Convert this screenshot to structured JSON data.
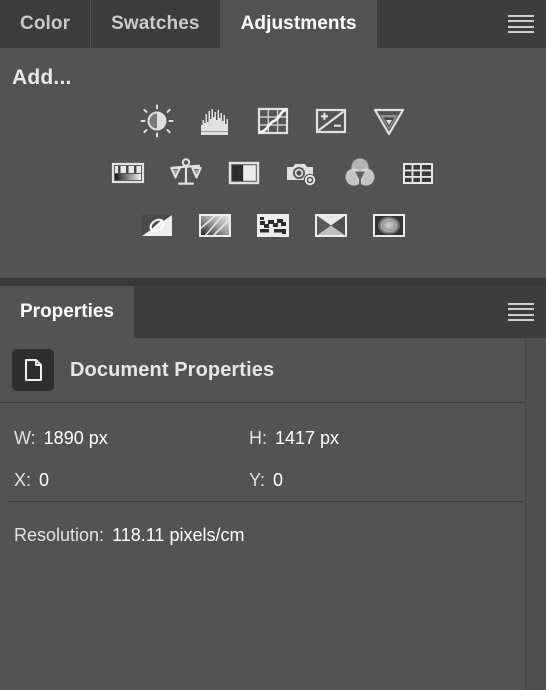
{
  "adjustments_panel": {
    "tabs": [
      {
        "label": "Color",
        "active": false
      },
      {
        "label": "Swatches",
        "active": false
      },
      {
        "label": "Adjustments",
        "active": true
      }
    ],
    "menu_icon": "hamburger-menu-icon",
    "add_label": "Add...",
    "icon_rows": [
      [
        {
          "name": "brightness-contrast-icon",
          "title": "Brightness/Contrast"
        },
        {
          "name": "levels-icon",
          "title": "Levels"
        },
        {
          "name": "curves-icon",
          "title": "Curves"
        },
        {
          "name": "exposure-icon",
          "title": "Exposure"
        },
        {
          "name": "vibrance-icon",
          "title": "Vibrance"
        }
      ],
      [
        {
          "name": "hue-saturation-icon",
          "title": "Hue/Saturation"
        },
        {
          "name": "color-balance-icon",
          "title": "Color Balance"
        },
        {
          "name": "black-and-white-icon",
          "title": "Black & White"
        },
        {
          "name": "photo-filter-icon",
          "title": "Photo Filter"
        },
        {
          "name": "channel-mixer-icon",
          "title": "Channel Mixer"
        },
        {
          "name": "color-lookup-icon",
          "title": "Color Lookup"
        }
      ],
      [
        {
          "name": "invert-icon",
          "title": "Invert"
        },
        {
          "name": "posterize-icon",
          "title": "Posterize"
        },
        {
          "name": "threshold-icon",
          "title": "Threshold"
        },
        {
          "name": "gradient-map-icon",
          "title": "Gradient Map"
        },
        {
          "name": "selective-color-icon",
          "title": "Selective Color"
        }
      ]
    ]
  },
  "properties_panel": {
    "tab_label": "Properties",
    "menu_icon": "hamburger-menu-icon",
    "document_icon": "document-page-icon",
    "section_title": "Document Properties",
    "fields": {
      "width_label": "W:",
      "width_value": "1890 px",
      "height_label": "H:",
      "height_value": "1417 px",
      "x_label": "X:",
      "x_value": "0",
      "y_label": "Y:",
      "y_value": "0",
      "resolution_label": "Resolution:",
      "resolution_value": "118.11 pixels/cm"
    }
  },
  "colors": {
    "panel_background": "#535353",
    "tabbar_background": "#3c3c3c",
    "divider": "#3b3b3b",
    "text_primary": "#ffffff",
    "text_secondary": "#c9c9c9",
    "icon_fill": "#e0e0e0",
    "doc_icon_background": "#2e2e2e"
  }
}
